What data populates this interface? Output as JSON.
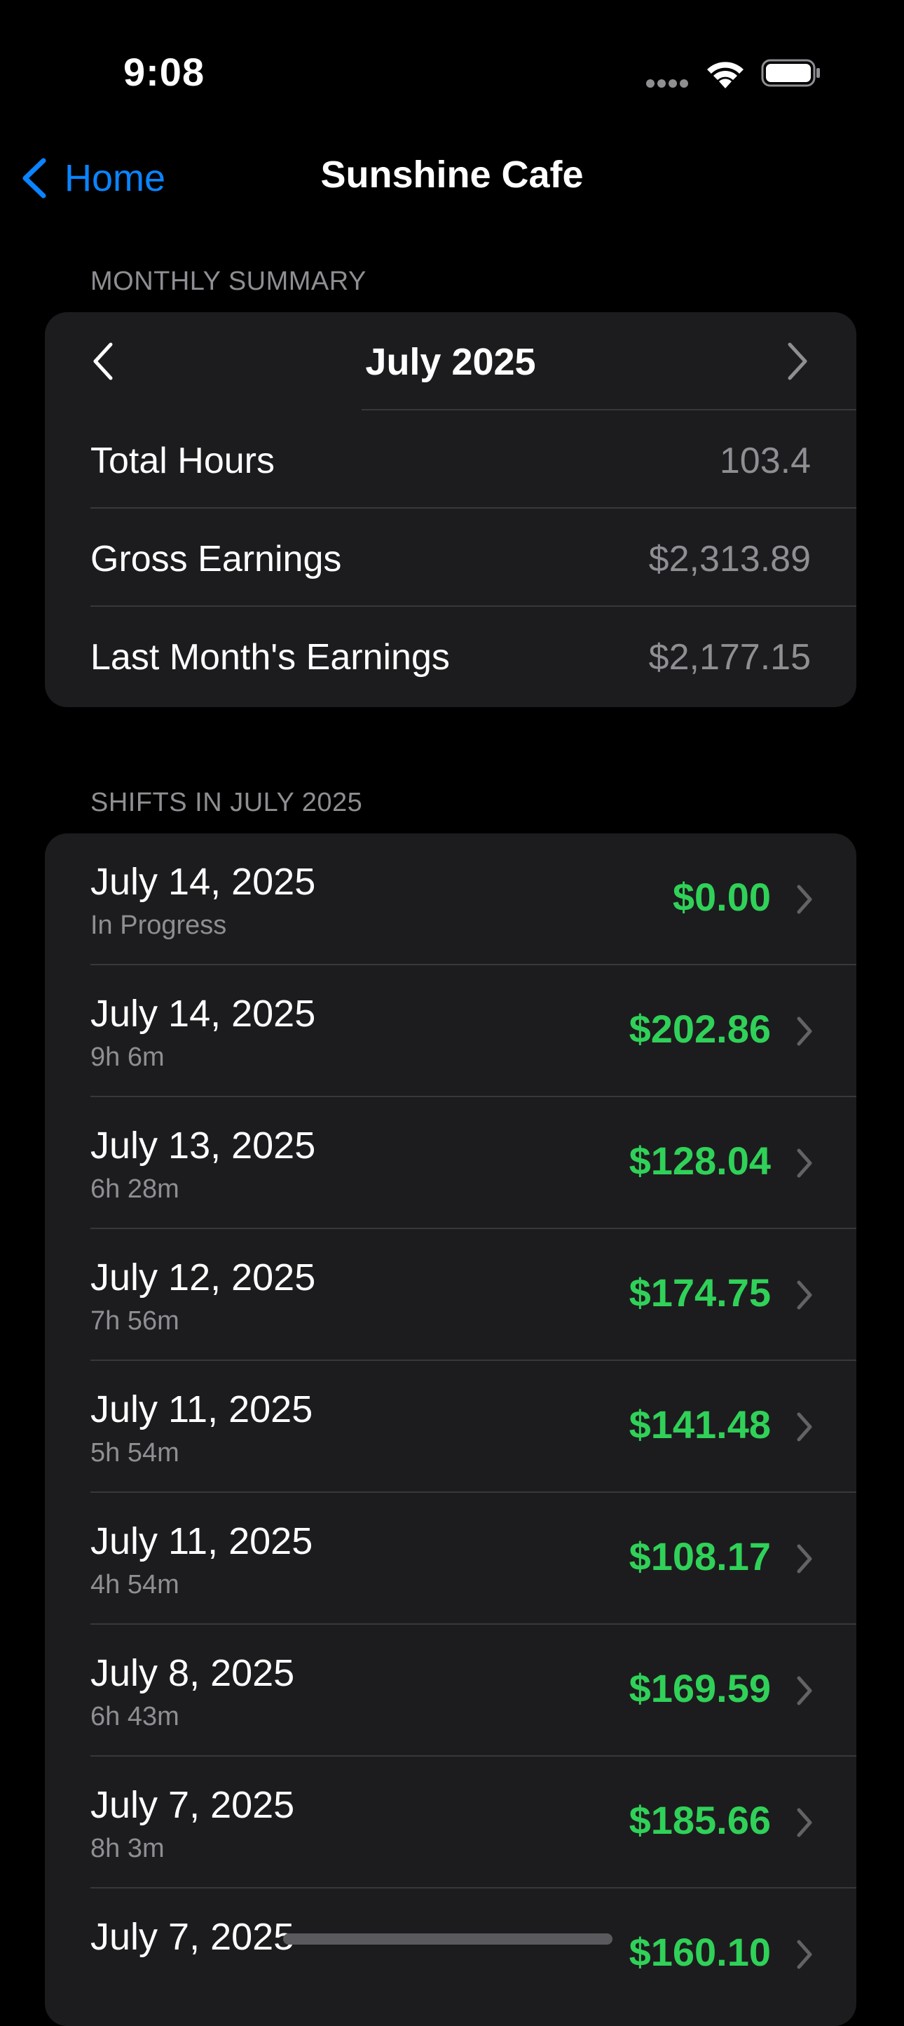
{
  "status_bar": {
    "time": "9:08"
  },
  "nav": {
    "back_label": "Home",
    "title": "Sunshine Cafe"
  },
  "summary": {
    "header": "MONTHLY SUMMARY",
    "month": "July 2025",
    "rows": [
      {
        "label": "Total Hours",
        "value": "103.4"
      },
      {
        "label": "Gross Earnings",
        "value": "$2,313.89"
      },
      {
        "label": "Last Month's Earnings",
        "value": "$2,177.15"
      }
    ]
  },
  "shifts": {
    "header": "SHIFTS IN JULY 2025",
    "items": [
      {
        "date": "July 14, 2025",
        "sub": "In Progress",
        "amount": "$0.00"
      },
      {
        "date": "July 14, 2025",
        "sub": "9h 6m",
        "amount": "$202.86"
      },
      {
        "date": "July 13, 2025",
        "sub": "6h 28m",
        "amount": "$128.04"
      },
      {
        "date": "July 12, 2025",
        "sub": "7h 56m",
        "amount": "$174.75"
      },
      {
        "date": "July 11, 2025",
        "sub": "5h 54m",
        "amount": "$141.48"
      },
      {
        "date": "July 11, 2025",
        "sub": "4h 54m",
        "amount": "$108.17"
      },
      {
        "date": "July 8, 2025",
        "sub": "6h 43m",
        "amount": "$169.59"
      },
      {
        "date": "July 7, 2025",
        "sub": "8h 3m",
        "amount": "$185.66"
      },
      {
        "date": "July 7, 2025",
        "sub": "",
        "amount": "$160.10"
      }
    ]
  },
  "colors": {
    "accent": "#0a84ff",
    "earnings": "#30d158",
    "card": "#1c1c1e",
    "secondary_text": "#8e8e93"
  },
  "icons": [
    "wifi-icon",
    "battery-icon",
    "chevron-left-icon",
    "chevron-right-icon"
  ]
}
